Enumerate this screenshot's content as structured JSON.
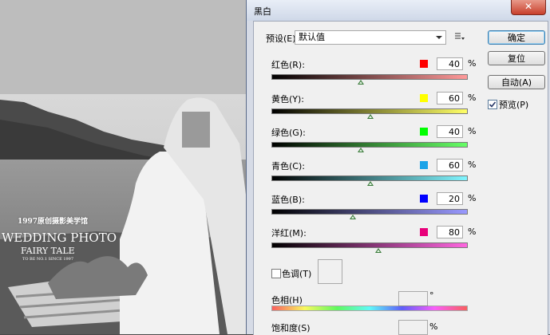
{
  "dialog": {
    "title": "黑白",
    "close_label": "✕"
  },
  "preset": {
    "label": "预设(E):",
    "value": "默认值",
    "menu_icon": "preset-menu-icon"
  },
  "sliders": [
    {
      "label": "红色(R):",
      "value": "40",
      "unit": "%",
      "swatch": "#ff0000",
      "fraction": 0.46,
      "gradient": [
        "#000000",
        "#ff9999"
      ]
    },
    {
      "label": "黄色(Y):",
      "value": "60",
      "unit": "%",
      "swatch": "#ffff00",
      "fraction": 0.51,
      "gradient": [
        "#000000",
        "#ffff66"
      ]
    },
    {
      "label": "绿色(G):",
      "value": "40",
      "unit": "%",
      "swatch": "#00ff00",
      "fraction": 0.46,
      "gradient": [
        "#000000",
        "#66ff66"
      ]
    },
    {
      "label": "青色(C):",
      "value": "60",
      "unit": "%",
      "swatch": "#1aa3e8",
      "fraction": 0.51,
      "gradient": [
        "#000000",
        "#80f5ff"
      ]
    },
    {
      "label": "蓝色(B):",
      "value": "20",
      "unit": "%",
      "swatch": "#0000ff",
      "fraction": 0.42,
      "gradient": [
        "#000000",
        "#9999ff"
      ]
    },
    {
      "label": "洋红(M):",
      "value": "80",
      "unit": "%",
      "swatch": "#e8007a",
      "fraction": 0.55,
      "gradient": [
        "#000000",
        "#ff66e0"
      ]
    }
  ],
  "tone": {
    "label": "色调(T)",
    "checked": false
  },
  "hue": {
    "label": "色相(H)",
    "unit": "°"
  },
  "saturation": {
    "label": "饱和度(S)",
    "unit": "%"
  },
  "buttons": {
    "ok": "确定",
    "reset": "复位",
    "auto": "自动(A)"
  },
  "preview": {
    "label": "预览(P)",
    "checked": true
  },
  "watermark": {
    "line1": "1997原创摄影美学馆",
    "line2": "WEDDING PHOTO",
    "line3": "FAIRY TALE",
    "line4": "TO BE NO.1 SINCE 1997"
  }
}
